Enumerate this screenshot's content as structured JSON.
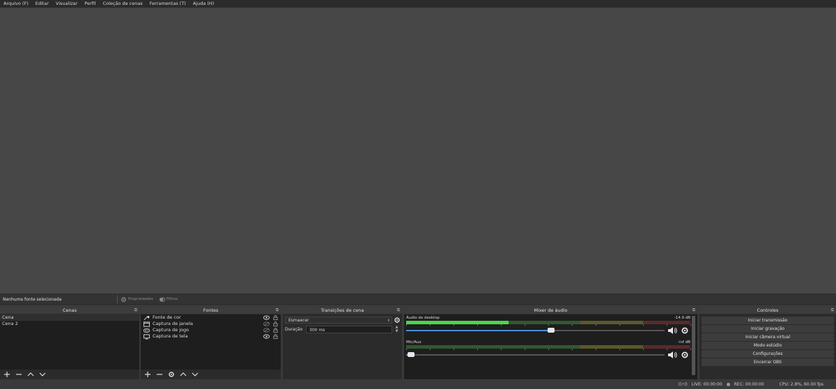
{
  "menu": [
    "Arquivo (F)",
    "Editar",
    "Visualizar",
    "Perfil",
    "Coleção de cenas",
    "Ferramentas (T)",
    "Ajuda (H)"
  ],
  "context_bar": {
    "selection_text": "Nenhuma fonte selecionada",
    "properties_label": "Propriedades",
    "filters_label": "Filtros"
  },
  "scenes": {
    "title": "Cenas",
    "items": [
      "Cena",
      "Cena 2"
    ],
    "selected": "Cena"
  },
  "sources": {
    "title": "Fontes",
    "items": [
      {
        "label": "Fonte de cor",
        "icon": "brush-icon"
      },
      {
        "label": "Captura de janela",
        "icon": "window-icon"
      },
      {
        "label": "Captura de jogo",
        "icon": "gamepad-icon"
      },
      {
        "label": "Captura de tela",
        "icon": "monitor-icon"
      }
    ]
  },
  "transitions": {
    "title": "Transições de cena",
    "selected": "Esmaecer",
    "duration_label": "Duração",
    "duration_value": "300 ms"
  },
  "mixer": {
    "title": "Mixer de áudio",
    "channels": [
      {
        "name": "Áudio do desktop",
        "db": "-14.9 dB",
        "volume": 0.56,
        "level": 0.36
      },
      {
        "name": "Mic/Aux",
        "db": "-inf dB",
        "volume": 0.02,
        "level": 0.0
      }
    ]
  },
  "controls": {
    "title": "Controles",
    "buttons": [
      "Iniciar transmissão",
      "Iniciar gravação",
      "Iniciar câmera virtual",
      "Modo estúdio",
      "Configurações",
      "Encerrar OBS"
    ]
  },
  "status": {
    "live": "LIVE: 00:00:00",
    "rec": "REC: 00:00:00",
    "cpu": "CPU: 2.8%, 60.00 fps"
  },
  "colors": {
    "meter_green": "#4bd64b",
    "meter_yellow": "#c9c93a",
    "meter_red": "#c94a4a",
    "slider_blue": "#4a90d9"
  }
}
